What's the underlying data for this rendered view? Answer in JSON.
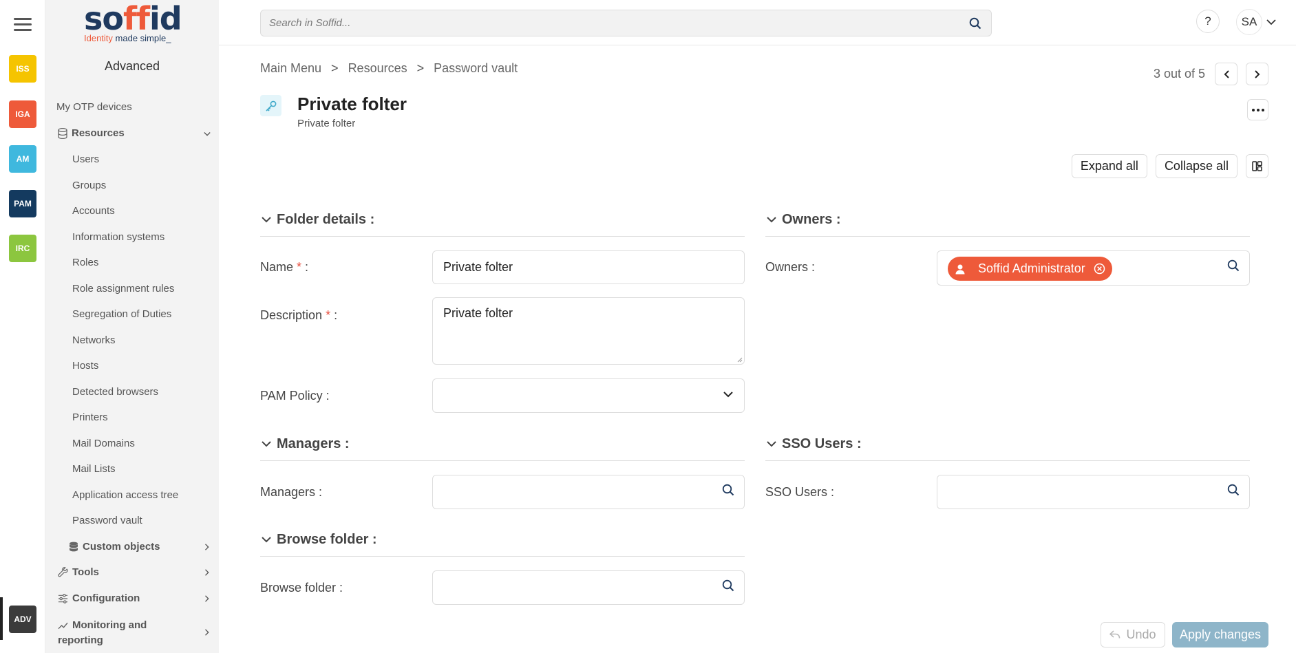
{
  "rail": {
    "badges": [
      {
        "label": "ISS",
        "color": "#f5c400"
      },
      {
        "label": "IGA",
        "color": "#ee5a3a"
      },
      {
        "label": "AM",
        "color": "#3fb8de"
      },
      {
        "label": "PAM",
        "color": "#143a5f"
      },
      {
        "label": "IRC",
        "color": "#8cc63f"
      },
      {
        "label": "ADV",
        "color": "#3b3b3b"
      }
    ]
  },
  "logo": {
    "wordmark_a": "so",
    "wordmark_b": "ff",
    "wordmark_c": "id",
    "tagline_a": "Identity ",
    "tagline_b": "made simple_"
  },
  "sidebar": {
    "section_title": "Advanced",
    "otp": "My OTP devices",
    "resources": "Resources",
    "items": [
      "Users",
      "Groups",
      "Accounts",
      "Information systems",
      "Roles",
      "Role assignment rules",
      "Segregation of Duties",
      "Networks",
      "Hosts",
      "Detected browsers",
      "Printers",
      "Mail Domains",
      "Mail Lists",
      "Application access tree",
      "Password vault"
    ],
    "custom_objects": "Custom objects",
    "tools": "Tools",
    "configuration": "Configuration",
    "monitoring_a": "Monitoring and",
    "monitoring_b": "reporting"
  },
  "topbar": {
    "search_placeholder": "Search in Soffid...",
    "help": "?",
    "user_initials": "SA"
  },
  "breadcrumb": {
    "items": [
      "Main Menu",
      "Resources",
      "Password vault"
    ],
    "separator": ">"
  },
  "pager": {
    "text": "3 out of 5"
  },
  "page": {
    "title": "Private folter",
    "subtitle": "Private folter"
  },
  "toolbar": {
    "expand": "Expand all",
    "collapse": "Collapse all"
  },
  "sections": {
    "folder_details": "Folder details :",
    "owners": "Owners :",
    "managers": "Managers :",
    "sso_users": "SSO Users :",
    "browse_folder": "Browse folder :"
  },
  "fields": {
    "name_label": "Name",
    "name_value": "Private folter",
    "description_label": "Description",
    "description_value": "Private folter",
    "pam_policy_label": "PAM Policy :",
    "pam_policy_value": "",
    "owners_label": "Owners :",
    "owner_chip": "Soffid Administrator",
    "managers_label": "Managers :",
    "sso_users_label": "SSO Users :",
    "browse_folder_label": "Browse folder :",
    "required_mark": "*",
    "label_suffix": " :"
  },
  "footer": {
    "undo": "Undo",
    "apply": "Apply changes"
  }
}
